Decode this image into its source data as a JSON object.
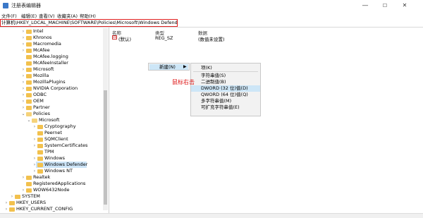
{
  "window": {
    "title": "注册表编辑器",
    "minimize": "—",
    "maximize": "☐",
    "close": "✕"
  },
  "menu": [
    "文件(F)",
    "编辑(E)",
    "查看(V)",
    "收藏夹(A)",
    "帮助(H)"
  ],
  "address": "计算机\\HKEY_LOCAL_MACHINE\\SOFTWARE\\Policies\\Microsoft\\Windows Defender",
  "tree": [
    {
      "label": "Intel"
    },
    {
      "label": "Khronos"
    },
    {
      "label": "Macromedia"
    },
    {
      "label": "McAfee"
    },
    {
      "label": "McAfee.logging"
    },
    {
      "label": "McAfeeInstaller"
    },
    {
      "label": "Microsoft"
    },
    {
      "label": "Mozilla"
    },
    {
      "label": "MozillaPlugins"
    },
    {
      "label": "NVIDIA Corporation"
    },
    {
      "label": "ODBC"
    },
    {
      "label": "OEM"
    },
    {
      "label": "Partner"
    },
    {
      "label": "Policies"
    },
    {
      "label": "Microsoft"
    },
    {
      "label": "Cryptography"
    },
    {
      "label": "Peernet"
    },
    {
      "label": "SQMClient"
    },
    {
      "label": "SystemCertificates"
    },
    {
      "label": "TPM"
    },
    {
      "label": "Windows"
    },
    {
      "label": "Windows Defender"
    },
    {
      "label": "Windows NT"
    },
    {
      "label": "Realtek"
    },
    {
      "label": "RegisteredApplications"
    },
    {
      "label": "WOW6432Node"
    },
    {
      "label": "SYSTEM"
    },
    {
      "label": "HKEY_USERS"
    },
    {
      "label": "HKEY_CURRENT_CONFIG"
    }
  ],
  "list": {
    "headers": [
      "名称",
      "类型",
      "数据"
    ],
    "rows": [
      {
        "name": "(默认)",
        "type": "REG_SZ",
        "data": "(数值未设置)",
        "icon": "ab"
      }
    ]
  },
  "context_menu": {
    "new_label": "新建(N)",
    "arrow": "▶"
  },
  "submenu": [
    "项(K)",
    "字符串值(S)",
    "二进制值(B)",
    "DWORD (32 位)值(D)",
    "QWORD (64 位)值(Q)",
    "多字符串值(M)",
    "可扩充字符串值(E)"
  ],
  "annotation": "鼠标右击"
}
